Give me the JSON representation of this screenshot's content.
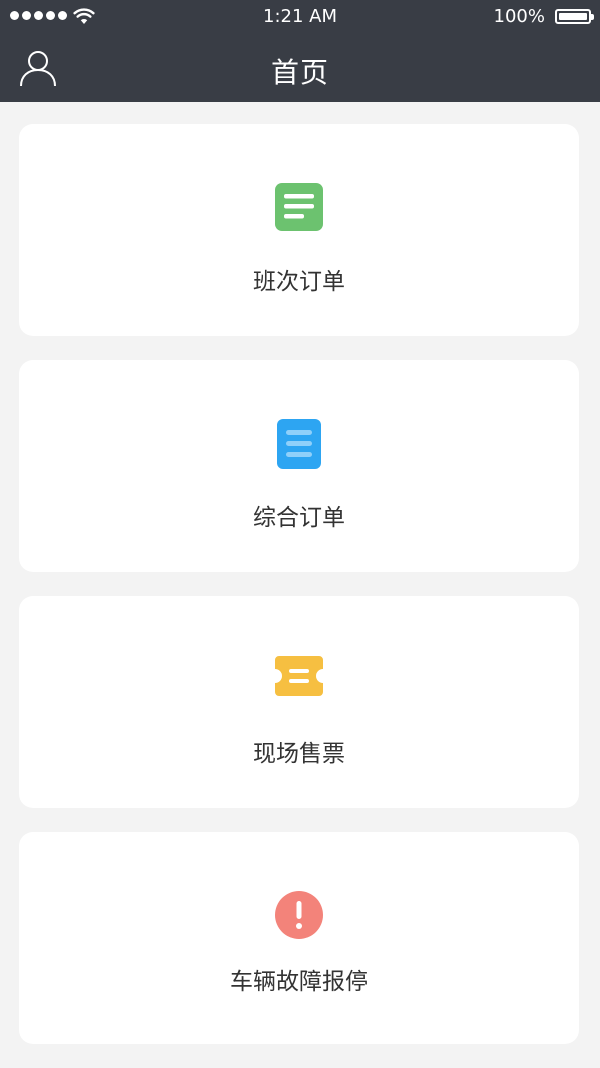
{
  "status_bar": {
    "time": "1:21 AM",
    "battery_percent": "100%"
  },
  "nav": {
    "title": "首页",
    "left_icon": "person-icon"
  },
  "cards": [
    {
      "label": "班次订单",
      "icon": "document-list-icon",
      "color": "#6cc26f"
    },
    {
      "label": "综合订单",
      "icon": "clipboard-list-icon",
      "color": "#2da5f2"
    },
    {
      "label": "现场售票",
      "icon": "ticket-icon",
      "color": "#f6bf41"
    },
    {
      "label": "车辆故障报停",
      "icon": "alert-icon",
      "color": "#f3837a"
    }
  ],
  "colors": {
    "header_bg": "#393d45",
    "page_bg": "#f3f3f3",
    "card_bg": "#ffffff"
  }
}
